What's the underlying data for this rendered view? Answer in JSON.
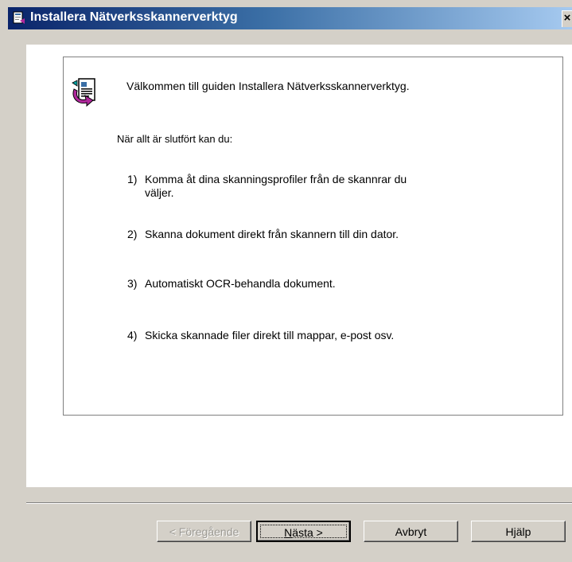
{
  "window": {
    "title": "Installera Nätverksskannerverktyg",
    "close_label": "×"
  },
  "content": {
    "welcome": "Välkommen till guiden Installera Nätverksskannerverktyg.",
    "intro": "När allt är slutfört kan du:",
    "items": [
      {
        "num": "1)",
        "text": "Komma åt dina skanningsprofiler från de skannrar du väljer."
      },
      {
        "num": "2)",
        "text": "Skanna dokument direkt från skannern till din dator."
      },
      {
        "num": "3)",
        "text": "Automatiskt OCR-behandla dokument."
      },
      {
        "num": "4)",
        "text": "Skicka skannade filer direkt till mappar, e-post osv."
      }
    ]
  },
  "buttons": {
    "back": "< Föregående",
    "next_prefix": "N",
    "next_rest": "ästa >",
    "cancel": "Avbryt",
    "help": "Hjälp"
  },
  "icons": {
    "title": "installer-icon",
    "wizard": "document-wizard-icon"
  },
  "colors": {
    "titlebar_start": "#0a246a",
    "titlebar_end": "#a6caf0",
    "face": "#d4d0c8"
  }
}
